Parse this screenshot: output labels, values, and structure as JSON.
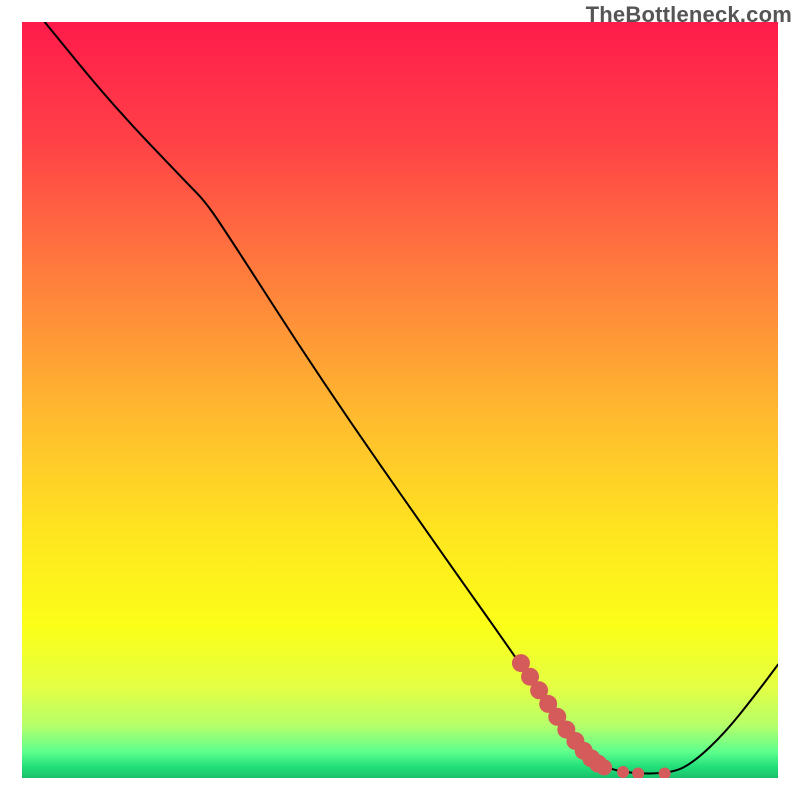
{
  "watermark": "TheBottleneck.com",
  "chart_data": {
    "type": "line",
    "title": "",
    "xlabel": "",
    "ylabel": "",
    "xlim": [
      0,
      100
    ],
    "ylim": [
      0,
      100
    ],
    "background_gradient_stops": [
      {
        "pos": 0.0,
        "color": "#ff1b4b"
      },
      {
        "pos": 0.16,
        "color": "#ff4247"
      },
      {
        "pos": 0.33,
        "color": "#ff7b3d"
      },
      {
        "pos": 0.52,
        "color": "#ffba2f"
      },
      {
        "pos": 0.68,
        "color": "#ffe61f"
      },
      {
        "pos": 0.8,
        "color": "#fbff18"
      },
      {
        "pos": 0.88,
        "color": "#e4ff44"
      },
      {
        "pos": 0.93,
        "color": "#b6ff6a"
      },
      {
        "pos": 0.965,
        "color": "#5fff8d"
      },
      {
        "pos": 0.985,
        "color": "#22e07a"
      },
      {
        "pos": 1.0,
        "color": "#18c06c"
      }
    ],
    "series": [
      {
        "name": "curve",
        "stroke": "#000000",
        "stroke_width": 2,
        "points": [
          {
            "x": 3,
            "y": 100
          },
          {
            "x": 12,
            "y": 89
          },
          {
            "x": 22,
            "y": 78.5
          },
          {
            "x": 24,
            "y": 76.5
          },
          {
            "x": 26.5,
            "y": 73
          },
          {
            "x": 40,
            "y": 52
          },
          {
            "x": 55,
            "y": 30.5
          },
          {
            "x": 66,
            "y": 15
          },
          {
            "x": 72,
            "y": 6
          },
          {
            "x": 76,
            "y": 1.8
          },
          {
            "x": 80,
            "y": 0.6
          },
          {
            "x": 86,
            "y": 0.6
          },
          {
            "x": 89,
            "y": 2.2
          },
          {
            "x": 93,
            "y": 6
          },
          {
            "x": 97,
            "y": 11
          },
          {
            "x": 100,
            "y": 15
          }
        ]
      }
    ],
    "highlight_dots": {
      "color": "#d55a5a",
      "radius_large": 9,
      "radius_small": 6,
      "points": [
        {
          "x": 66.0,
          "y": 15.2,
          "r": 9
        },
        {
          "x": 67.2,
          "y": 13.4,
          "r": 9
        },
        {
          "x": 68.4,
          "y": 11.6,
          "r": 9
        },
        {
          "x": 69.6,
          "y": 9.8,
          "r": 9
        },
        {
          "x": 70.8,
          "y": 8.1,
          "r": 9
        },
        {
          "x": 72.0,
          "y": 6.4,
          "r": 9
        },
        {
          "x": 73.2,
          "y": 4.9,
          "r": 9
        },
        {
          "x": 74.3,
          "y": 3.6,
          "r": 9
        },
        {
          "x": 75.3,
          "y": 2.6,
          "r": 9
        },
        {
          "x": 76.2,
          "y": 1.9,
          "r": 9
        },
        {
          "x": 77.0,
          "y": 1.4,
          "r": 8
        },
        {
          "x": 79.5,
          "y": 0.8,
          "r": 6
        },
        {
          "x": 81.5,
          "y": 0.6,
          "r": 6
        },
        {
          "x": 85.0,
          "y": 0.6,
          "r": 6
        }
      ]
    }
  }
}
